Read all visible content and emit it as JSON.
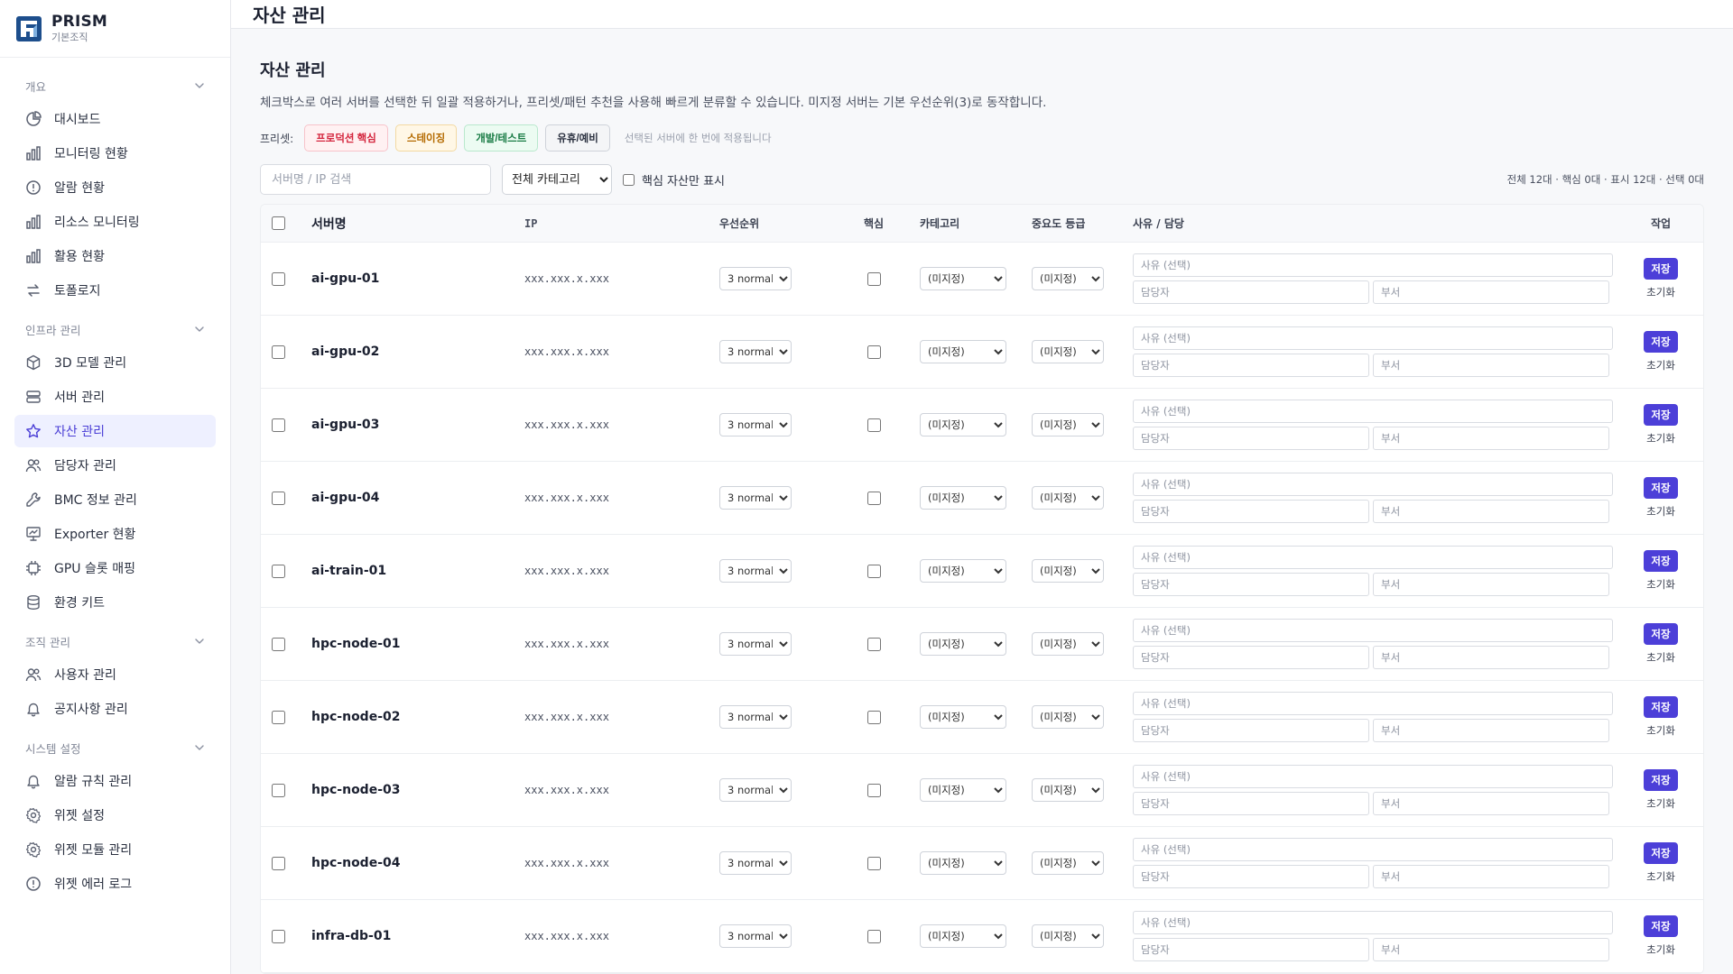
{
  "brand": {
    "name": "PRISM",
    "sub": "기본조직"
  },
  "header": {
    "title": "자산 관리"
  },
  "nav": {
    "sections": [
      {
        "label": "개요",
        "items": [
          {
            "label": "대시보드",
            "icon": "pie-chart-icon"
          },
          {
            "label": "모니터링 현황",
            "icon": "bar-chart-icon"
          },
          {
            "label": "알람 현황",
            "icon": "alert-circle-icon"
          },
          {
            "label": "리소스 모니터링",
            "icon": "bar-chart-icon"
          },
          {
            "label": "활용 현황",
            "icon": "bar-chart-icon"
          },
          {
            "label": "토폴로지",
            "icon": "arrows-swap-icon"
          }
        ]
      },
      {
        "label": "인프라 관리",
        "items": [
          {
            "label": "3D 모델 관리",
            "icon": "cube-icon"
          },
          {
            "label": "서버 관리",
            "icon": "server-icon"
          },
          {
            "label": "자산 관리",
            "icon": "star-icon",
            "active": true
          },
          {
            "label": "담당자 관리",
            "icon": "users-icon"
          },
          {
            "label": "BMC 정보 관리",
            "icon": "wrench-icon"
          },
          {
            "label": "Exporter 현황",
            "icon": "presentation-icon"
          },
          {
            "label": "GPU 슬롯 매핑",
            "icon": "chip-icon"
          },
          {
            "label": "환경 키트",
            "icon": "database-icon"
          }
        ]
      },
      {
        "label": "조직 관리",
        "items": [
          {
            "label": "사용자 관리",
            "icon": "users-icon"
          },
          {
            "label": "공지사항 관리",
            "icon": "bell-icon"
          }
        ]
      },
      {
        "label": "시스템 설정",
        "items": [
          {
            "label": "알람 규칙 관리",
            "icon": "bell-icon"
          },
          {
            "label": "위젯 설정",
            "icon": "gear-icon"
          },
          {
            "label": "위젯 모듈 관리",
            "icon": "gear-icon"
          },
          {
            "label": "위젯 에러 로그",
            "icon": "alert-circle-icon"
          }
        ]
      }
    ]
  },
  "page": {
    "title": "자산 관리",
    "description": "체크박스로 여러 서버를 선택한 뒤 일괄 적용하거나, 프리셋/패턴 추천을 사용해 빠르게 분류할 수 있습니다. 미지정 서버는 기본 우선순위(3)로 동작합니다."
  },
  "presets": {
    "label": "프리셋:",
    "items": [
      "프로덕션 핵심",
      "스테이징",
      "개발/테스트",
      "유휴/예비"
    ],
    "hint": "선택된 서버에 한 번에 적용됩니다"
  },
  "filters": {
    "search_placeholder": "서버명 / IP 검색",
    "category_selected": "전체 카테고리",
    "core_only_label": "핵심 자산만 표시",
    "summary": "전체 12대 · 핵심 0대 · 표시 12대 · 선택 0대"
  },
  "table": {
    "headers": {
      "name": "서버명",
      "ip": "IP",
      "priority": "우선순위",
      "core": "핵심",
      "category": "카테고리",
      "importance": "중요도 등급",
      "reason": "사유 / 담당",
      "action": "작업"
    },
    "priority_value": "3 normal",
    "category_value": "(미지정)",
    "importance_value": "(미지정)",
    "reason_placeholder": "사유 (선택)",
    "manager_placeholder": "담당자",
    "dept_placeholder": "부서",
    "save_label": "저장",
    "reset_label": "초기화",
    "rows": [
      {
        "name": "ai-gpu-01",
        "ip": "xxx.xxx.x.xxx"
      },
      {
        "name": "ai-gpu-02",
        "ip": "xxx.xxx.x.xxx"
      },
      {
        "name": "ai-gpu-03",
        "ip": "xxx.xxx.x.xxx"
      },
      {
        "name": "ai-gpu-04",
        "ip": "xxx.xxx.x.xxx"
      },
      {
        "name": "ai-train-01",
        "ip": "xxx.xxx.x.xxx"
      },
      {
        "name": "hpc-node-01",
        "ip": "xxx.xxx.x.xxx"
      },
      {
        "name": "hpc-node-02",
        "ip": "xxx.xxx.x.xxx"
      },
      {
        "name": "hpc-node-03",
        "ip": "xxx.xxx.x.xxx"
      },
      {
        "name": "hpc-node-04",
        "ip": "xxx.xxx.x.xxx"
      },
      {
        "name": "infra-db-01",
        "ip": "xxx.xxx.x.xxx"
      }
    ]
  },
  "colors": {
    "accent": "#4c3fd8",
    "active_bg": "#eef0ff"
  }
}
